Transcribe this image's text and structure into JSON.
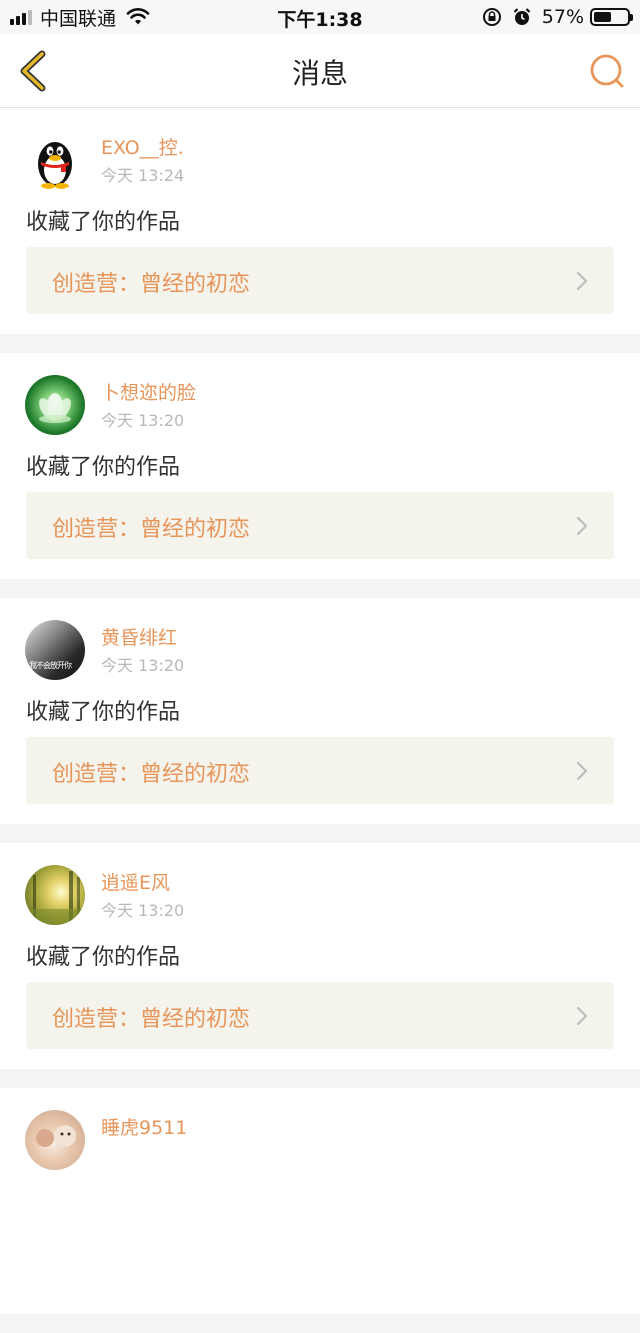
{
  "status_bar": {
    "carrier": "中国联通",
    "time": "下午1:38",
    "battery_pct": "57%",
    "battery_level": 0.57
  },
  "nav": {
    "title": "消息"
  },
  "colors": {
    "accent": "#e8955a",
    "back_icon": "#e5b82a"
  },
  "messages": [
    {
      "username": "EXO__控.",
      "time": "今天 13:24",
      "action": "收藏了你的作品",
      "work_title": "创造营：曾经的初恋",
      "avatar": "qq-penguin"
    },
    {
      "username": "卜想迩的脸",
      "time": "今天 13:20",
      "action": "收藏了你的作品",
      "work_title": "创造营：曾经的初恋",
      "avatar": "lotus-flower"
    },
    {
      "username": "黄昏绯红",
      "time": "今天 13:20",
      "action": "收藏了你的作品",
      "work_title": "创造营：曾经的初恋",
      "avatar": "dark-photo",
      "avatar_caption": "我不会放开你"
    },
    {
      "username": "逍遥E风",
      "time": "今天 13:20",
      "action": "收藏了你的作品",
      "work_title": "创造营：曾经的初恋",
      "avatar": "forest-photo"
    },
    {
      "username": "睡虎9511",
      "avatar": "pet-photo"
    }
  ]
}
